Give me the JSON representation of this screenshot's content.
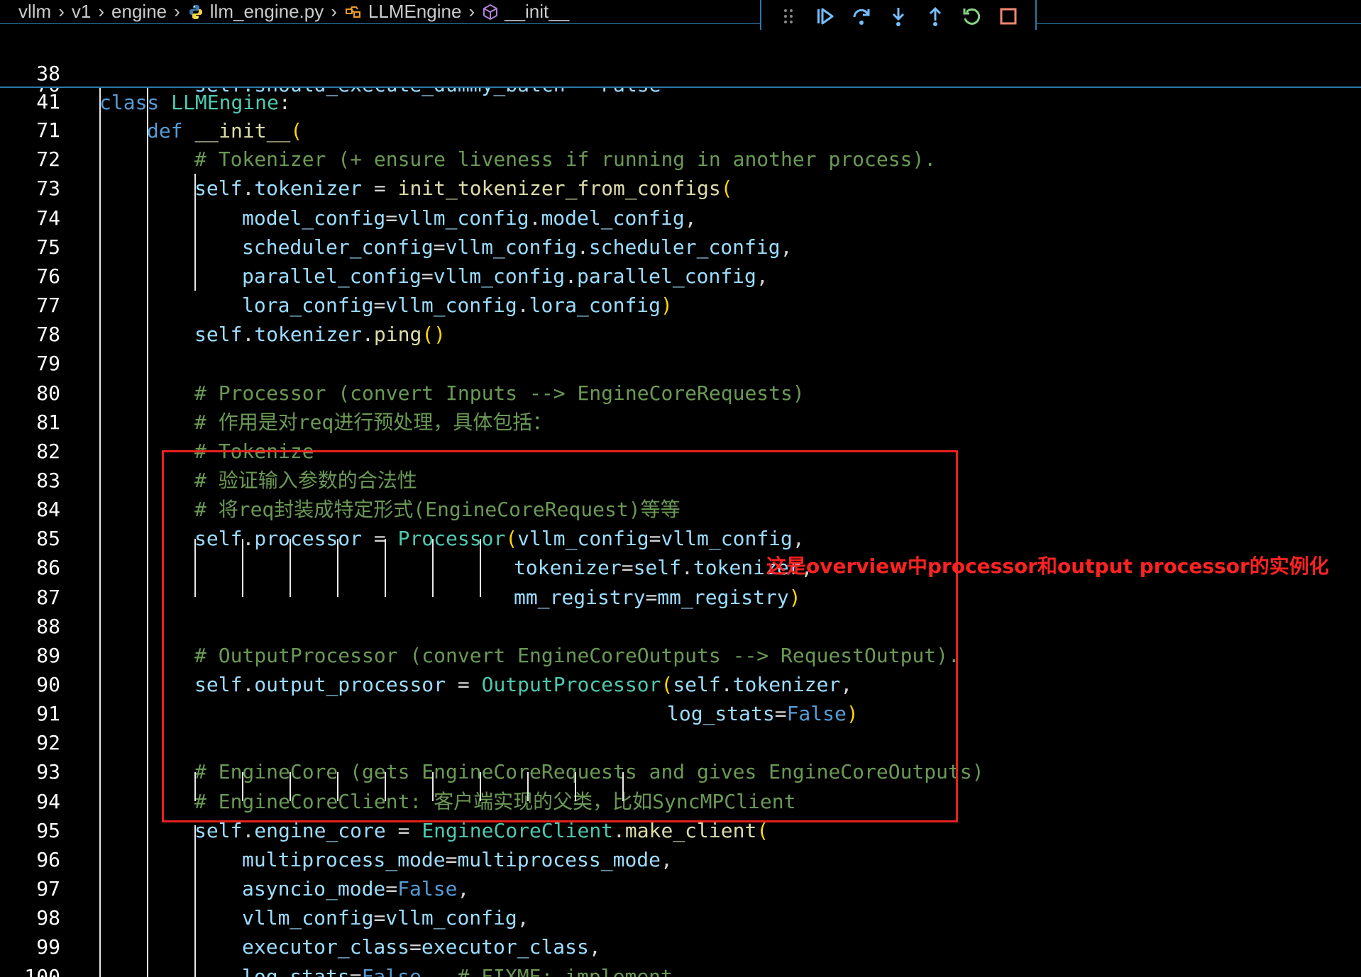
{
  "breadcrumb": [
    {
      "label": "vllm",
      "icon": ""
    },
    {
      "label": "v1",
      "icon": ""
    },
    {
      "label": "engine",
      "icon": ""
    },
    {
      "label": "llm_engine.py",
      "icon": "python-file-icon"
    },
    {
      "label": "LLMEngine",
      "icon": "class-icon"
    },
    {
      "label": "__init__",
      "icon": "method-cube-icon"
    }
  ],
  "debug_toolbar": [
    {
      "name": "drag-handle-icon"
    },
    {
      "name": "continue-icon"
    },
    {
      "name": "step-over-icon"
    },
    {
      "name": "step-into-icon"
    },
    {
      "name": "step-out-icon"
    },
    {
      "name": "restart-icon"
    },
    {
      "name": "stop-icon"
    }
  ],
  "sticky": {
    "line1_num": "38",
    "line1_kw": "class",
    "line1_name": "LLMEngine",
    "line1_tail": ":",
    "line2_num": "41",
    "line2_kw": "def",
    "line2_name": "__init__",
    "line2_paren": "("
  },
  "lines": {
    "70": "self.should_execute_dummy_batch = False",
    "72": "# Tokenizer (+ ensure liveness if running in another process).",
    "80": "# Processor (convert Inputs --> EngineCoreRequests)",
    "81": "# 作用是对req进行预处理，具体包括：",
    "82": "# Tokenize",
    "83": "# 验证输入参数的合法性",
    "84": "# 将req封装成特定形式(EngineCoreRequest)等等",
    "89": "# OutputProcessor (convert EngineCoreOutputs --> RequestOutput).",
    "93": "# EngineCore (gets EngineCoreRequests and gives EngineCoreOutputs)",
    "94": "# EngineCoreClient: 客户端实现的父类，比如SyncMPClient",
    "100_comment": "# FIXME: implement"
  },
  "annotation": "这是overview中processor和output processor的实例化",
  "colors": {
    "background": "#000000",
    "keyword": "#569cd6",
    "class_name": "#4ec9b0",
    "function": "#dcdcaa",
    "variable": "#9cdcfe",
    "comment": "#6a9955",
    "bracket_gold": "#ffd700",
    "highlight_border": "#e8211d",
    "annotation_text": "#ff2222"
  }
}
